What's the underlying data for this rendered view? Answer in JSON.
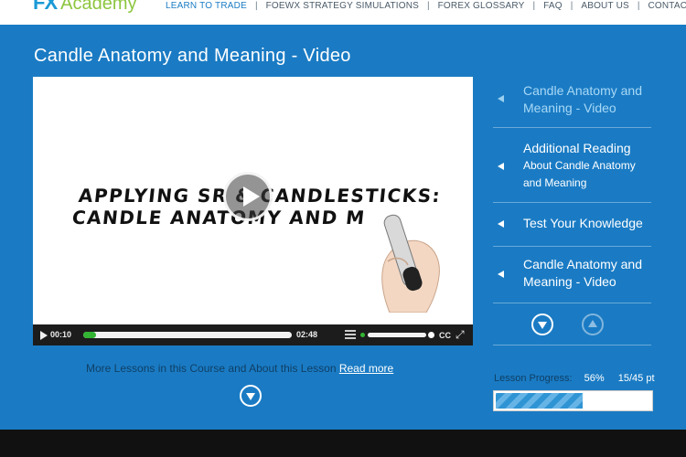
{
  "brand": {
    "fx": "FX",
    "academy": "Academy"
  },
  "nav": [
    {
      "label": "LEARN TO TRADE",
      "active": true
    },
    {
      "label": "FOEWX STRATEGY SIMULATIONS",
      "active": false
    },
    {
      "label": "FOREX GLOSSARY",
      "active": false
    },
    {
      "label": "FAQ",
      "active": false
    },
    {
      "label": "ABOUT US",
      "active": false
    },
    {
      "label": "CONTACT US",
      "active": false
    }
  ],
  "nav_separator": "|",
  "page": {
    "title": "Candle Anatomy and Meaning - Video"
  },
  "video": {
    "text_line1": "APPLYING SR & CANDLESTICKS:",
    "text_line2": "CANDLE ANATOMY AND M",
    "current_time": "00:10",
    "duration": "02:48",
    "played_fraction": 0.06,
    "cc_label": "CC"
  },
  "more_lessons": {
    "text": "More Lessons in this Course and About this Lesson",
    "link": "Read more"
  },
  "sidebar": {
    "items": [
      {
        "line1": "Candle Anatomy and",
        "line2": "Meaning - Video",
        "current": true
      },
      {
        "line1": "Additional Reading",
        "line2": "About Candle Anatomy",
        "line3": "and Meaning",
        "current": false
      },
      {
        "line1": "Test Your Knowledge",
        "current": false
      },
      {
        "line1": "Candle Anatomy and",
        "line2": "Meaning - Video",
        "current": false
      }
    ]
  },
  "progress": {
    "label": "Lesson Progress:",
    "percent_text": "56%",
    "points_text": "15/45 pt",
    "fraction": 0.56
  },
  "colors": {
    "accent": "#1a7bc4",
    "footer": "#111111",
    "brand_green": "#8cc63f"
  }
}
